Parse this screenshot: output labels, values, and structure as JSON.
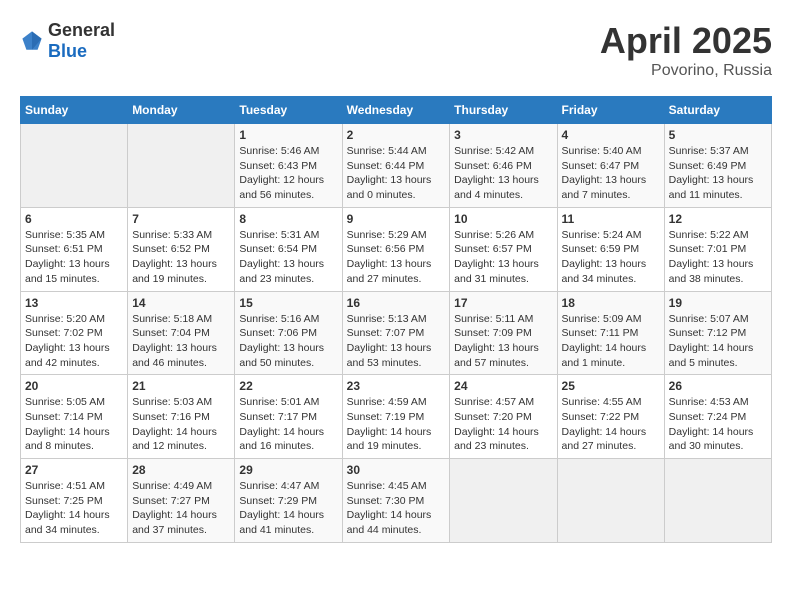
{
  "header": {
    "logo": {
      "general": "General",
      "blue": "Blue"
    },
    "title": "April 2025",
    "location": "Povorino, Russia"
  },
  "calendar": {
    "days_of_week": [
      "Sunday",
      "Monday",
      "Tuesday",
      "Wednesday",
      "Thursday",
      "Friday",
      "Saturday"
    ],
    "weeks": [
      [
        {
          "day": null,
          "sunrise": null,
          "sunset": null,
          "daylight": null
        },
        {
          "day": null,
          "sunrise": null,
          "sunset": null,
          "daylight": null
        },
        {
          "day": "1",
          "sunrise": "Sunrise: 5:46 AM",
          "sunset": "Sunset: 6:43 PM",
          "daylight": "Daylight: 12 hours and 56 minutes."
        },
        {
          "day": "2",
          "sunrise": "Sunrise: 5:44 AM",
          "sunset": "Sunset: 6:44 PM",
          "daylight": "Daylight: 13 hours and 0 minutes."
        },
        {
          "day": "3",
          "sunrise": "Sunrise: 5:42 AM",
          "sunset": "Sunset: 6:46 PM",
          "daylight": "Daylight: 13 hours and 4 minutes."
        },
        {
          "day": "4",
          "sunrise": "Sunrise: 5:40 AM",
          "sunset": "Sunset: 6:47 PM",
          "daylight": "Daylight: 13 hours and 7 minutes."
        },
        {
          "day": "5",
          "sunrise": "Sunrise: 5:37 AM",
          "sunset": "Sunset: 6:49 PM",
          "daylight": "Daylight: 13 hours and 11 minutes."
        }
      ],
      [
        {
          "day": "6",
          "sunrise": "Sunrise: 5:35 AM",
          "sunset": "Sunset: 6:51 PM",
          "daylight": "Daylight: 13 hours and 15 minutes."
        },
        {
          "day": "7",
          "sunrise": "Sunrise: 5:33 AM",
          "sunset": "Sunset: 6:52 PM",
          "daylight": "Daylight: 13 hours and 19 minutes."
        },
        {
          "day": "8",
          "sunrise": "Sunrise: 5:31 AM",
          "sunset": "Sunset: 6:54 PM",
          "daylight": "Daylight: 13 hours and 23 minutes."
        },
        {
          "day": "9",
          "sunrise": "Sunrise: 5:29 AM",
          "sunset": "Sunset: 6:56 PM",
          "daylight": "Daylight: 13 hours and 27 minutes."
        },
        {
          "day": "10",
          "sunrise": "Sunrise: 5:26 AM",
          "sunset": "Sunset: 6:57 PM",
          "daylight": "Daylight: 13 hours and 31 minutes."
        },
        {
          "day": "11",
          "sunrise": "Sunrise: 5:24 AM",
          "sunset": "Sunset: 6:59 PM",
          "daylight": "Daylight: 13 hours and 34 minutes."
        },
        {
          "day": "12",
          "sunrise": "Sunrise: 5:22 AM",
          "sunset": "Sunset: 7:01 PM",
          "daylight": "Daylight: 13 hours and 38 minutes."
        }
      ],
      [
        {
          "day": "13",
          "sunrise": "Sunrise: 5:20 AM",
          "sunset": "Sunset: 7:02 PM",
          "daylight": "Daylight: 13 hours and 42 minutes."
        },
        {
          "day": "14",
          "sunrise": "Sunrise: 5:18 AM",
          "sunset": "Sunset: 7:04 PM",
          "daylight": "Daylight: 13 hours and 46 minutes."
        },
        {
          "day": "15",
          "sunrise": "Sunrise: 5:16 AM",
          "sunset": "Sunset: 7:06 PM",
          "daylight": "Daylight: 13 hours and 50 minutes."
        },
        {
          "day": "16",
          "sunrise": "Sunrise: 5:13 AM",
          "sunset": "Sunset: 7:07 PM",
          "daylight": "Daylight: 13 hours and 53 minutes."
        },
        {
          "day": "17",
          "sunrise": "Sunrise: 5:11 AM",
          "sunset": "Sunset: 7:09 PM",
          "daylight": "Daylight: 13 hours and 57 minutes."
        },
        {
          "day": "18",
          "sunrise": "Sunrise: 5:09 AM",
          "sunset": "Sunset: 7:11 PM",
          "daylight": "Daylight: 14 hours and 1 minute."
        },
        {
          "day": "19",
          "sunrise": "Sunrise: 5:07 AM",
          "sunset": "Sunset: 7:12 PM",
          "daylight": "Daylight: 14 hours and 5 minutes."
        }
      ],
      [
        {
          "day": "20",
          "sunrise": "Sunrise: 5:05 AM",
          "sunset": "Sunset: 7:14 PM",
          "daylight": "Daylight: 14 hours and 8 minutes."
        },
        {
          "day": "21",
          "sunrise": "Sunrise: 5:03 AM",
          "sunset": "Sunset: 7:16 PM",
          "daylight": "Daylight: 14 hours and 12 minutes."
        },
        {
          "day": "22",
          "sunrise": "Sunrise: 5:01 AM",
          "sunset": "Sunset: 7:17 PM",
          "daylight": "Daylight: 14 hours and 16 minutes."
        },
        {
          "day": "23",
          "sunrise": "Sunrise: 4:59 AM",
          "sunset": "Sunset: 7:19 PM",
          "daylight": "Daylight: 14 hours and 19 minutes."
        },
        {
          "day": "24",
          "sunrise": "Sunrise: 4:57 AM",
          "sunset": "Sunset: 7:20 PM",
          "daylight": "Daylight: 14 hours and 23 minutes."
        },
        {
          "day": "25",
          "sunrise": "Sunrise: 4:55 AM",
          "sunset": "Sunset: 7:22 PM",
          "daylight": "Daylight: 14 hours and 27 minutes."
        },
        {
          "day": "26",
          "sunrise": "Sunrise: 4:53 AM",
          "sunset": "Sunset: 7:24 PM",
          "daylight": "Daylight: 14 hours and 30 minutes."
        }
      ],
      [
        {
          "day": "27",
          "sunrise": "Sunrise: 4:51 AM",
          "sunset": "Sunset: 7:25 PM",
          "daylight": "Daylight: 14 hours and 34 minutes."
        },
        {
          "day": "28",
          "sunrise": "Sunrise: 4:49 AM",
          "sunset": "Sunset: 7:27 PM",
          "daylight": "Daylight: 14 hours and 37 minutes."
        },
        {
          "day": "29",
          "sunrise": "Sunrise: 4:47 AM",
          "sunset": "Sunset: 7:29 PM",
          "daylight": "Daylight: 14 hours and 41 minutes."
        },
        {
          "day": "30",
          "sunrise": "Sunrise: 4:45 AM",
          "sunset": "Sunset: 7:30 PM",
          "daylight": "Daylight: 14 hours and 44 minutes."
        },
        {
          "day": null,
          "sunrise": null,
          "sunset": null,
          "daylight": null
        },
        {
          "day": null,
          "sunrise": null,
          "sunset": null,
          "daylight": null
        },
        {
          "day": null,
          "sunrise": null,
          "sunset": null,
          "daylight": null
        }
      ]
    ]
  }
}
